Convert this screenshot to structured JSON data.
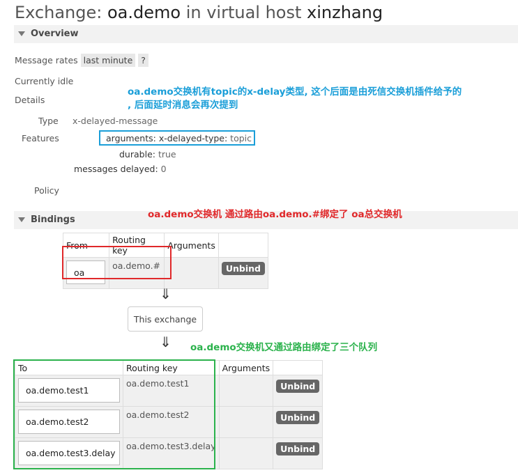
{
  "title": {
    "prefix": "Exchange: ",
    "exchange": "oa.demo",
    "middle": " in virtual host ",
    "vhost": "xinzhang"
  },
  "overview": {
    "heading": "Overview",
    "message_rates_label": "Message rates",
    "message_rates_value": "last minute",
    "help_label": "?",
    "status": "Currently idle",
    "details_label": "Details",
    "type_label": "Type",
    "type_value": "x-delayed-message",
    "features_label": "Features",
    "arguments_label": "arguments:",
    "arguments_key": "x-delayed-type:",
    "arguments_value": "topic",
    "durable_label": "durable:",
    "durable_value": "true",
    "messages_delayed_label": "messages delayed:",
    "messages_delayed_value": "0",
    "policy_label": "Policy"
  },
  "annotations": {
    "blue_line1": "oa.demo交换机有topic的x-delay类型, 这个后面是由死信交换机插件给予的",
    "blue_line2": ", 后面延时消息会再次提到",
    "red": "oa.demo交换机 通过路由oa.demo.#绑定了 oa总交换机",
    "green": "oa.demo交换机又通过路由绑定了三个队列"
  },
  "bindings": {
    "heading": "Bindings",
    "source_headers": [
      "From",
      "Routing key",
      "Arguments",
      ""
    ],
    "source_rows": [
      {
        "from": "oa",
        "routing_key": "oa.demo.#",
        "arguments": "",
        "action": "Unbind"
      }
    ],
    "arrow": "⇓",
    "this_exchange": "This exchange",
    "dest_headers": [
      "To",
      "Routing key",
      "Arguments",
      ""
    ],
    "dest_rows": [
      {
        "to": "oa.demo.test1",
        "routing_key": "oa.demo.test1",
        "arguments": "",
        "action": "Unbind"
      },
      {
        "to": "oa.demo.test2",
        "routing_key": "oa.demo.test2",
        "arguments": "",
        "action": "Unbind"
      },
      {
        "to": "oa.demo.test3.delay",
        "routing_key": "oa.demo.test3.delay",
        "arguments": "",
        "action": "Unbind"
      }
    ]
  },
  "colors": {
    "annotation_blue": "#1a9ed8",
    "annotation_red": "#e0282a",
    "annotation_green": "#2bb24c",
    "unbind_button": "#666666"
  }
}
